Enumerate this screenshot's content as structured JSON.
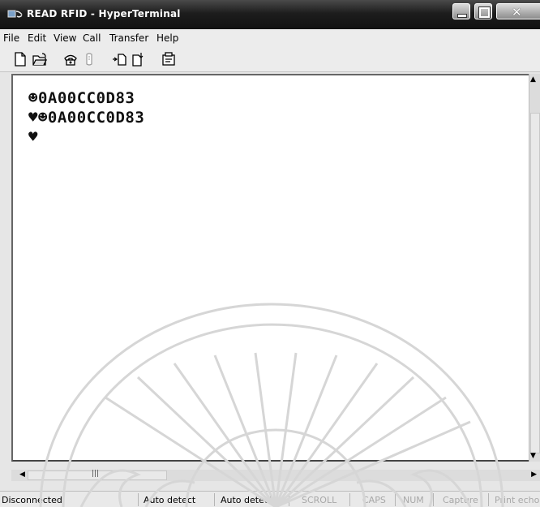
{
  "window": {
    "title": "READ RFID - HyperTerminal"
  },
  "menu": [
    "File",
    "Edit",
    "View",
    "Call",
    "Transfer",
    "Help"
  ],
  "toolbar": {
    "icons": [
      "new-connection-icon",
      "open-icon",
      "connect-phone-icon",
      "disconnect-phone-icon",
      "send-icon",
      "receive-icon",
      "properties-icon"
    ]
  },
  "terminal": {
    "lines": [
      "☻0A00CC0D83",
      "♥☻0A00CC0D83",
      "♥"
    ]
  },
  "scrollbar": {
    "h_grip": "|||"
  },
  "status": {
    "connection": "Disconnected",
    "detect1": "Auto detect",
    "detect2": "Auto detect",
    "scroll": "SCROLL",
    "caps": "CAPS",
    "num": "NUM",
    "capture": "Capture",
    "print": "Print echo"
  },
  "colors": {
    "titlebar": "#1d1d1d",
    "terminal_bg": "#ffffff",
    "chrome": "#ececec"
  }
}
